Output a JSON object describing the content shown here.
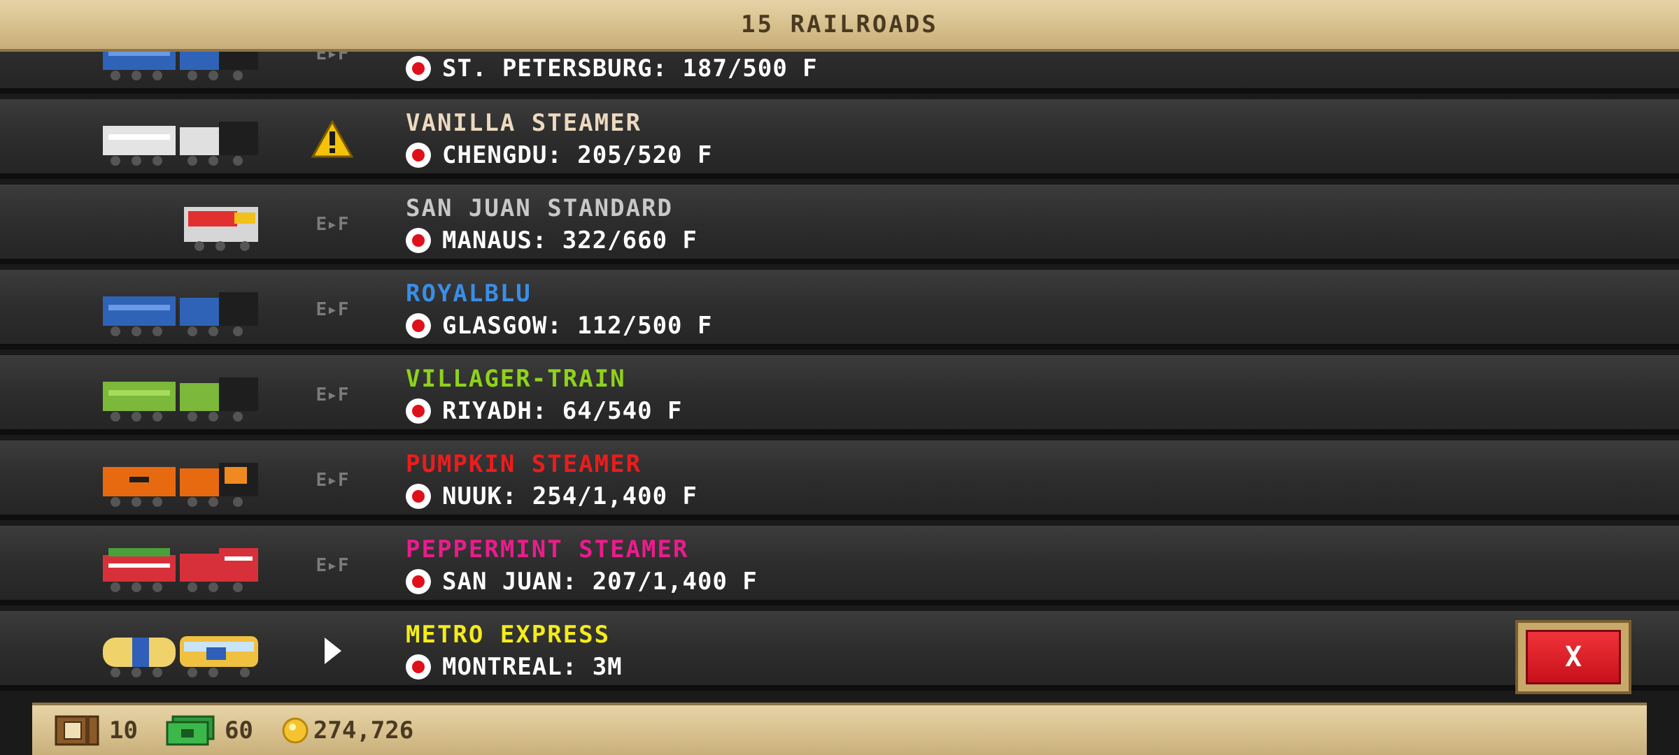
{
  "header": {
    "title": "15 RAILROADS"
  },
  "rows": [
    {
      "name": "",
      "name_color": "#ffffff",
      "dest": "ST. PETERSBURG: 187/500 F",
      "status": "E▸F",
      "train": "royal-blue-steam"
    },
    {
      "name": "VANILLA STEAMER",
      "name_color": "#ecd9bf",
      "dest": "CHENGDU: 205/520 F",
      "status": "warning",
      "train": "vanilla-steam"
    },
    {
      "name": "SAN JUAN STANDARD",
      "name_color": "#c8c8c8",
      "dest": "MANAUS: 322/660 F",
      "status": "E▸F",
      "train": "san-juan-diesel"
    },
    {
      "name": "ROYALBLU",
      "name_color": "#3a8ee6",
      "dest": "GLASGOW: 112/500 F",
      "status": "E▸F",
      "train": "royal-blue-steam"
    },
    {
      "name": "VILLAGER-TRAIN",
      "name_color": "#8ed31a",
      "dest": "RIYADH: 64/540 F",
      "status": "E▸F",
      "train": "green-steam"
    },
    {
      "name": "PUMPKIN STEAMER",
      "name_color": "#ec1c1c",
      "dest": "NUUK: 254/1,400 F",
      "status": "E▸F",
      "train": "pumpkin-steam"
    },
    {
      "name": "PEPPERMINT STEAMER",
      "name_color": "#ea1c8c",
      "dest": "SAN JUAN: 207/1,400 F",
      "status": "E▸F",
      "train": "peppermint-steam"
    },
    {
      "name": "METRO EXPRESS",
      "name_color": "#f4ec1a",
      "dest": "MONTREAL: 3M",
      "status": "play",
      "train": "metro-express"
    }
  ],
  "close_button": {
    "label": "X"
  },
  "footer": {
    "crates": "10",
    "cash": "60",
    "coins": "274,726"
  },
  "colors": {
    "accent_red": "#e0101a",
    "panel_tan": "#d6bf8c"
  }
}
